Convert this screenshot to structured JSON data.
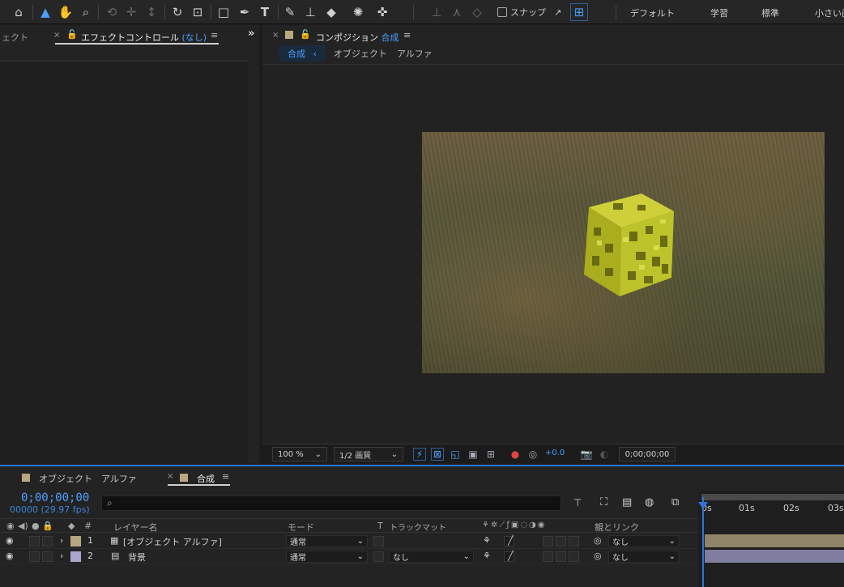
{
  "toolbar": {
    "snap_label": "スナップ",
    "workspaces": [
      "デフォルト",
      "学習",
      "標準",
      "小さい画"
    ]
  },
  "effects_panel": {
    "prev_tab_label": "ェクト",
    "tab_label": "エフェクトコントロール",
    "tab_status": "(なし)"
  },
  "comp_panel": {
    "tab_label": "コンポジション",
    "tab_comp": "合成",
    "breadcrumb": [
      "合成",
      "オブジェクト",
      "アルファ"
    ],
    "zoom": "100 %",
    "resolution": "1/2 画質",
    "exposure": "+0.0",
    "timecode": "0;00;00;00"
  },
  "timeline": {
    "tabs": [
      {
        "label": "オブジェクト　アルファ",
        "color": "#b8a77f"
      },
      {
        "label": "合成",
        "color": "#b8a77f"
      }
    ],
    "timecode": "0;00;00;00",
    "frame_info": "00000 (29.97 fps)",
    "search_icon": "⌕",
    "columns": {
      "number": "#",
      "layer_name": "レイヤー名",
      "mode": "モード",
      "t": "T",
      "track_matte": "トラックマット",
      "parent": "親とリンク"
    },
    "layers": [
      {
        "num": "1",
        "name": "[オブジェクト アルファ]",
        "color": "#b8a77f",
        "mode": "通常",
        "matte": "",
        "parent": "なし"
      },
      {
        "num": "2",
        "name": "背景",
        "color": "#a9a6cc",
        "mode": "通常",
        "matte": "なし",
        "parent": "なし"
      }
    ],
    "ruler_ticks": [
      "0s",
      "01s",
      "02s",
      "03s"
    ]
  }
}
